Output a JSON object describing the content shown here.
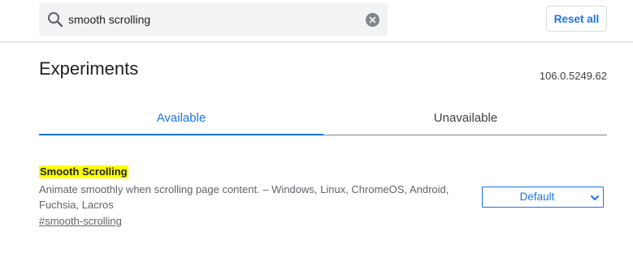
{
  "header": {
    "search": {
      "value": "smooth scrolling"
    },
    "reset_label": "Reset all"
  },
  "main": {
    "title": "Experiments",
    "version": "106.0.5249.62",
    "tabs": [
      {
        "label": "Available",
        "selected": true
      },
      {
        "label": "Unavailable",
        "selected": false
      }
    ],
    "experiments": [
      {
        "name": "Smooth Scrolling",
        "description": "Animate smoothly when scrolling page content. – Windows, Linux, ChromeOS, Android, Fuchsia, Lacros",
        "link": "#smooth-scrolling",
        "selected_option": "Default"
      }
    ]
  },
  "colors": {
    "accent": "#1a73e8",
    "highlight": "#ffff00",
    "search_background": "#f1f3f4"
  },
  "icons": {
    "search": "search-icon",
    "clear": "clear-icon",
    "dropdown": "chevron-down-icon"
  }
}
